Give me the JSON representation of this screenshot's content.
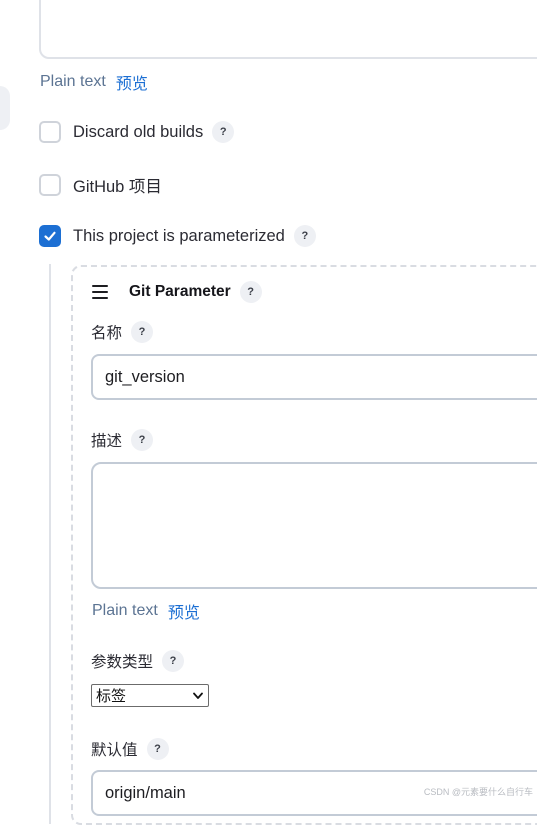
{
  "top_section": {
    "plain_text": "Plain text",
    "preview": "预览"
  },
  "options": [
    {
      "label": "Discard old builds",
      "checked": false,
      "help": "?"
    },
    {
      "label": "GitHub 项目",
      "checked": false
    },
    {
      "label": "This project is parameterized",
      "checked": true,
      "help": "?"
    }
  ],
  "git_parameter": {
    "title": "Git Parameter",
    "help": "?",
    "name_label": "名称",
    "name_value": "git_version",
    "description_label": "描述",
    "plain_text": "Plain text",
    "preview": "预览",
    "param_type_label": "参数类型",
    "param_type_selected": "标签",
    "default_value_label": "默认值",
    "default_value": "origin/main"
  },
  "colors": {
    "accent": "#1c6fd3",
    "link_muted": "#5c7493",
    "input_border": "#c3cbd6"
  },
  "watermark": "CSDN @元素要什么自行车"
}
